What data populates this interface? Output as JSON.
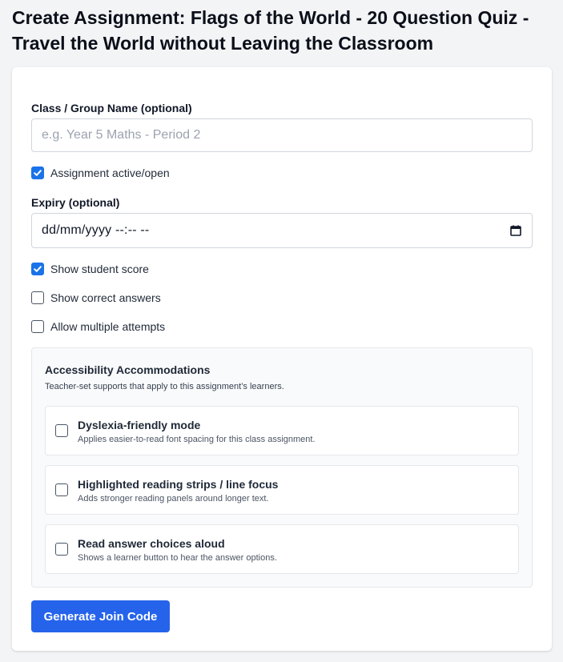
{
  "page": {
    "title": "Create Assignment: Flags of the World - 20 Question Quiz - Travel the World without Leaving the Classroom"
  },
  "form": {
    "class_group": {
      "label": "Class / Group Name (optional)",
      "value": "",
      "placeholder": "e.g. Year 5 Maths - Period 2"
    },
    "assignment_active": {
      "label": "Assignment active/open",
      "checked": true
    },
    "expiry": {
      "label": "Expiry (optional)",
      "value": "dd/mm/yyyy --:-- --",
      "icon": "calendar-icon"
    },
    "show_student_score": {
      "label": "Show student score",
      "checked": true
    },
    "show_correct_answers": {
      "label": "Show correct answers",
      "checked": false
    },
    "allow_multiple_attempts": {
      "label": "Allow multiple attempts",
      "checked": false
    }
  },
  "accessibility": {
    "title": "Accessibility Accommodations",
    "subtitle": "Teacher-set supports that apply to this assignment’s learners.",
    "options": [
      {
        "title": "Dyslexia-friendly mode",
        "description": "Applies easier-to-read font spacing for this class assignment.",
        "checked": false
      },
      {
        "title": "Highlighted reading strips / line focus",
        "description": "Adds stronger reading panels around longer text.",
        "checked": false
      },
      {
        "title": "Read answer choices aloud",
        "description": "Shows a learner button to hear the answer options.",
        "checked": false
      }
    ]
  },
  "actions": {
    "generate_label": "Generate Join Code"
  },
  "colors": {
    "accent": "#2563eb",
    "checkbox_checked": "#1a73e8",
    "background": "#f3f4f6",
    "card": "#ffffff"
  }
}
